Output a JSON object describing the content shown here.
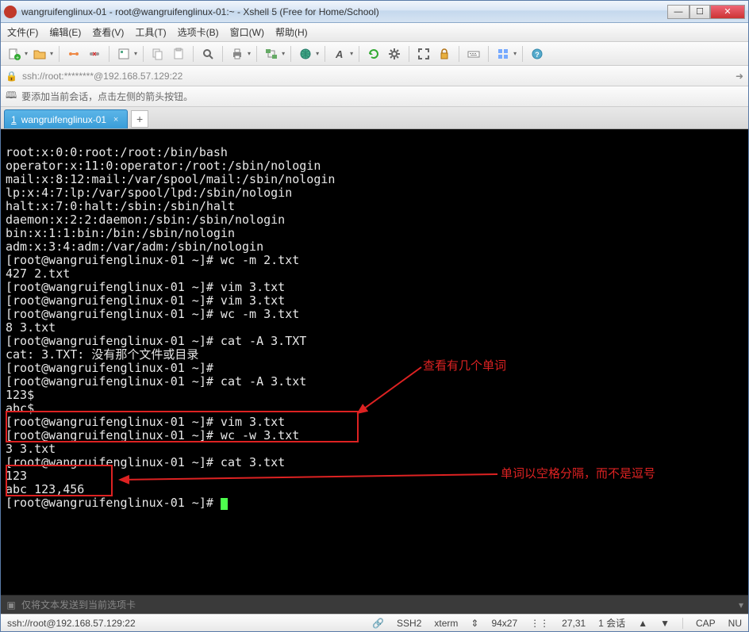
{
  "window": {
    "title": "wangruifenglinux-01 - root@wangruifenglinux-01:~ - Xshell 5 (Free for Home/School)"
  },
  "menu": {
    "file": "文件(F)",
    "edit": "编辑(E)",
    "view": "查看(V)",
    "tools": "工具(T)",
    "options": "选项卡(B)",
    "window": "窗口(W)",
    "help": "帮助(H)"
  },
  "address": {
    "url": "ssh://root:********@192.168.57.129:22"
  },
  "info_hint": "要添加当前会话，点击左侧的箭头按钮。",
  "tab": {
    "num": "1",
    "label": "wangruifenglinux-01"
  },
  "terminal_lines": [
    "root:x:0:0:root:/root:/bin/bash",
    "operator:x:11:0:operator:/root:/sbin/nologin",
    "mail:x:8:12:mail:/var/spool/mail:/sbin/nologin",
    "lp:x:4:7:lp:/var/spool/lpd:/sbin/nologin",
    "halt:x:7:0:halt:/sbin:/sbin/halt",
    "daemon:x:2:2:daemon:/sbin:/sbin/nologin",
    "bin:x:1:1:bin:/bin:/sbin/nologin",
    "adm:x:3:4:adm:/var/adm:/sbin/nologin",
    "[root@wangruifenglinux-01 ~]# wc -m 2.txt",
    "427 2.txt",
    "[root@wangruifenglinux-01 ~]# vim 3.txt",
    "[root@wangruifenglinux-01 ~]# vim 3.txt",
    "[root@wangruifenglinux-01 ~]# wc -m 3.txt",
    "8 3.txt",
    "[root@wangruifenglinux-01 ~]# cat -A 3.TXT",
    "cat: 3.TXT: 没有那个文件或目录",
    "[root@wangruifenglinux-01 ~]# ",
    "[root@wangruifenglinux-01 ~]# cat -A 3.txt",
    "123$",
    "abc$",
    "[root@wangruifenglinux-01 ~]# vim 3.txt",
    "[root@wangruifenglinux-01 ~]# wc -w 3.txt",
    "3 3.txt",
    "[root@wangruifenglinux-01 ~]# cat 3.txt",
    "123",
    "abc 123,456",
    "[root@wangruifenglinux-01 ~]# "
  ],
  "annotations": {
    "a1": "查看有几个单词",
    "a2": "单词以空格分隔，而不是逗号"
  },
  "send_placeholder": "仅将文本发送到当前选项卡",
  "status": {
    "url": "ssh://root@192.168.57.129:22",
    "proto": "SSH2",
    "term": "xterm",
    "size": "94x27",
    "pos": "27,31",
    "sess": "1 会话",
    "cap": "CAP",
    "num": "NU"
  },
  "icons": {
    "arrow_marker": "▸",
    "plus": "+",
    "close": "×",
    "minus": "—",
    "max": "☐",
    "xclose": "✕",
    "link": "↔",
    "caret": "▾"
  }
}
